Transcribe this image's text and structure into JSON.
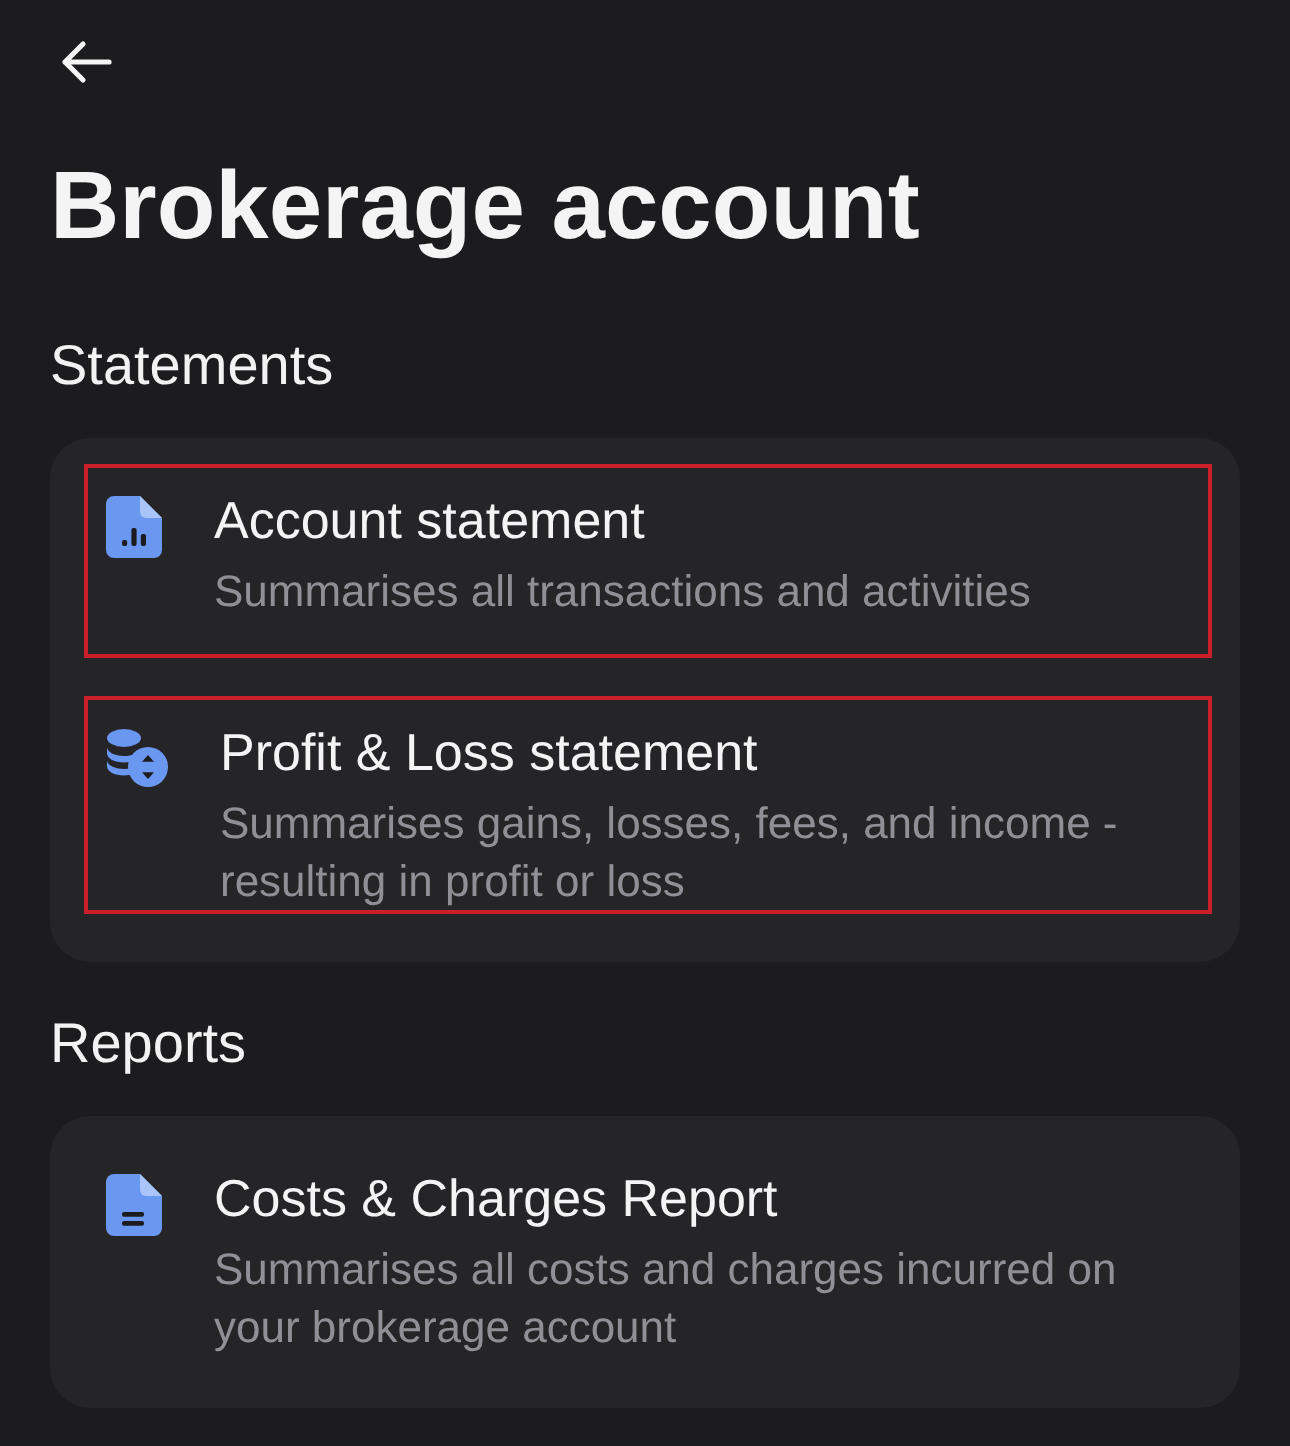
{
  "page": {
    "title": "Brokerage account"
  },
  "sections": [
    {
      "heading": "Statements",
      "items": [
        {
          "kind": "chart-document",
          "title": "Account statement",
          "description": "Summarises all transactions and activities",
          "highlighted": true
        },
        {
          "kind": "coins",
          "title": "Profit & Loss statement",
          "description": "Summarises gains, losses, fees, and income - resulting in profit or loss",
          "highlighted": true
        }
      ]
    },
    {
      "heading": "Reports",
      "items": [
        {
          "kind": "text-document",
          "title": "Costs & Charges Report",
          "description": "Summarises all costs and charges incurred on your brokerage account",
          "highlighted": false
        }
      ]
    }
  ]
}
